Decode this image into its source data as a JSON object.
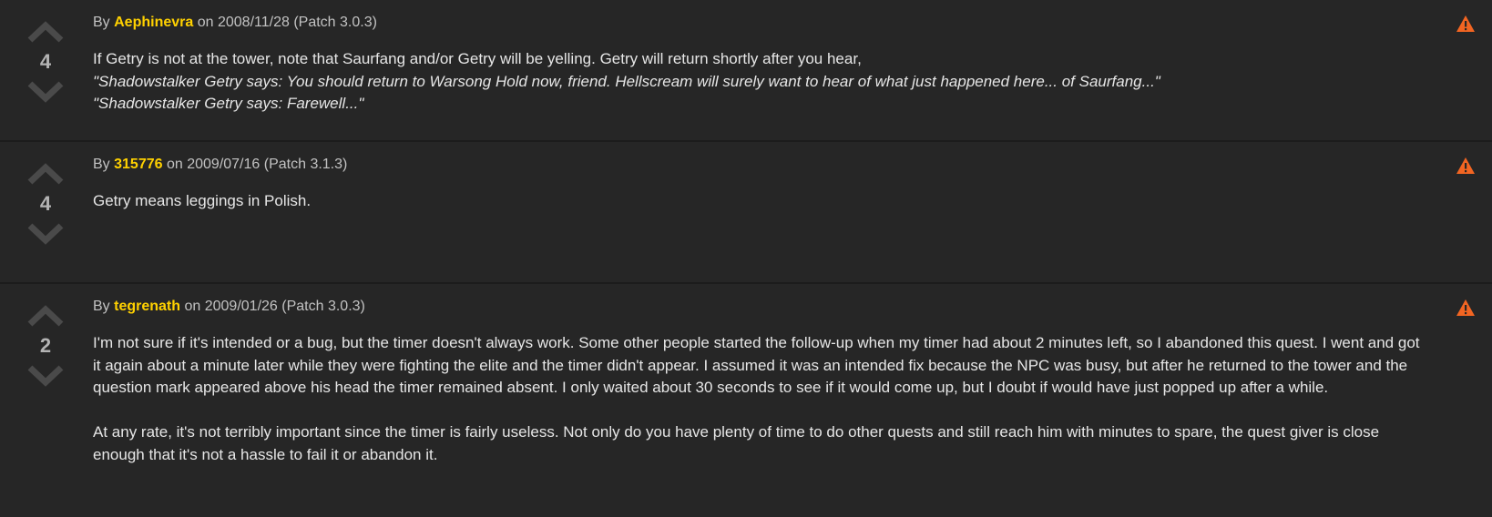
{
  "comments": [
    {
      "score": "4",
      "by_label": "By",
      "author": "Aephinevra",
      "on_label": "on",
      "date": "2008/11/28",
      "patch": "(Patch 3.0.3)",
      "lines": [
        "If Getry is not at the tower, note that Saurfang and/or Getry will be yelling. Getry will return shortly after you hear,",
        "\"Shadowstalker Getry says: You should return to Warsong Hold now, friend. Hellscream will surely want to hear of what just happened here... of Saurfang...\"",
        "\"Shadowstalker Getry says: Farewell...\""
      ]
    },
    {
      "score": "4",
      "by_label": "By",
      "author": "315776",
      "on_label": "on",
      "date": "2009/07/16",
      "patch": "(Patch 3.1.3)",
      "lines": [
        "Getry means leggings in Polish."
      ]
    },
    {
      "score": "2",
      "by_label": "By",
      "author": "tegrenath",
      "on_label": "on",
      "date": "2009/01/26",
      "patch": "(Patch 3.0.3)",
      "paragraphs": [
        "I'm not sure if it's intended or a bug, but the timer doesn't always work. Some other people started the follow-up when my timer had about 2 minutes left, so I abandoned this quest. I went and got it again about a minute later while they were fighting the elite and the timer didn't appear. I assumed it was an intended fix because the NPC was busy, but after he returned to the tower and the question mark appeared above his head the timer remained absent. I only waited about 30 seconds to see if it would come up, but I doubt if would have just popped up after a while.",
        "At any rate, it's not terribly important since the timer is fairly useless. Not only do you have plenty of time to do other quests and still reach him with minutes to spare, the quest giver is close enough that it's not a hassle to fail it or abandon it."
      ]
    }
  ],
  "icons": {
    "upvote": "chevron-up-icon",
    "downvote": "chevron-down-icon",
    "report": "warning-icon"
  },
  "colors": {
    "author": "#ffd100",
    "report": "#f26522",
    "arrow": "#4a4a4a",
    "background": "#262626"
  }
}
